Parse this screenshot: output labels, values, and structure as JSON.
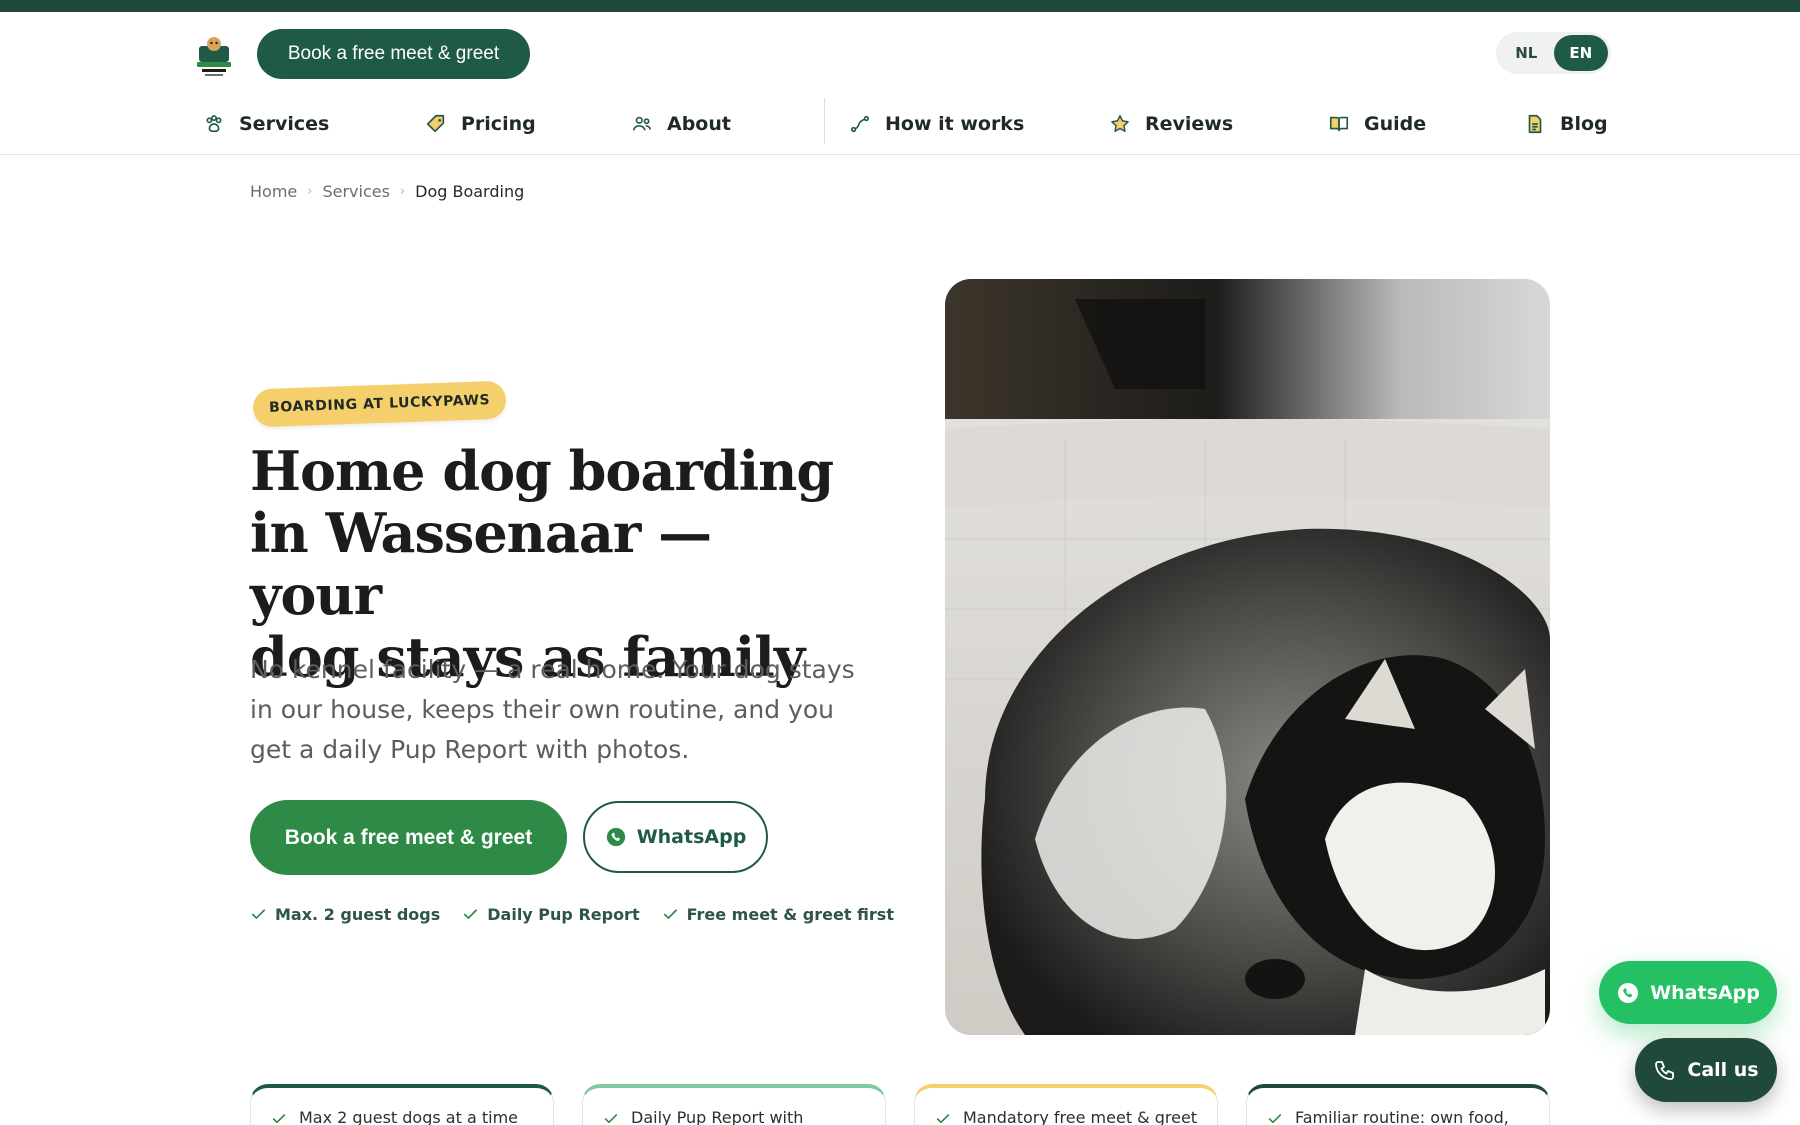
{
  "header": {
    "logo_alt": "Lucky Paws",
    "cta_label": "Book a free meet & greet",
    "languages": [
      "NL",
      "EN"
    ],
    "active_language": "EN"
  },
  "nav": {
    "items": [
      {
        "label": "Services",
        "icon": "paw-icon"
      },
      {
        "label": "Pricing",
        "icon": "tag-icon"
      },
      {
        "label": "About",
        "icon": "people-icon"
      },
      {
        "label": "How it works",
        "icon": "route-icon"
      },
      {
        "label": "Reviews",
        "icon": "star-icon"
      },
      {
        "label": "Guide",
        "icon": "book-icon"
      },
      {
        "label": "Blog",
        "icon": "document-icon"
      }
    ]
  },
  "breadcrumb": {
    "items": [
      "Home",
      "Services",
      "Dog Boarding"
    ]
  },
  "hero": {
    "badge": "BOARDING AT LUCKYPAWS",
    "title_line1": "Home dog boarding",
    "title_line2": "in Wassenaar — your",
    "title_line3": "dog stays as family",
    "subtitle": "No kennel facility — a real home. Your dog stays in our house, keeps their own routine, and you get a daily Pup Report with photos.",
    "primary_cta": "Book a free meet & greet",
    "whatsapp_cta": "WhatsApp",
    "checks": [
      "Max. 2 guest dogs",
      "Daily Pup Report",
      "Free meet & greet first"
    ],
    "image_alt": "Husky sleeping on a sofa"
  },
  "floating": {
    "whatsapp_label": "WhatsApp",
    "call_label": "Call us"
  },
  "cards": [
    {
      "label": "Max 2 guest dogs at a time",
      "accent": "#1f5a47"
    },
    {
      "label": "Daily Pup Report with",
      "accent": "#7fc9a2"
    },
    {
      "label": "Mandatory free meet & greet",
      "accent": "#f5cf6b"
    },
    {
      "label": "Familiar routine: own food,",
      "accent": "#1f4a3a"
    }
  ],
  "colors": {
    "brand_dark": "#1f4a3a",
    "brand_green": "#2e8b47",
    "whatsapp_green": "#25c064",
    "badge_yellow": "#f5cf6b"
  }
}
